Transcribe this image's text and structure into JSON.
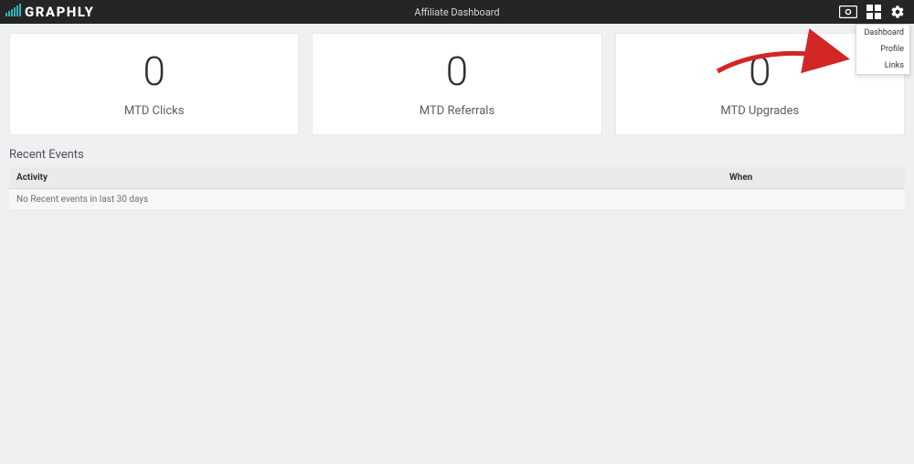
{
  "header": {
    "brand": "GRAPHLY",
    "title": "Affiliate Dashboard"
  },
  "dropdown": {
    "items": [
      "Dashboard",
      "Profile",
      "Links"
    ]
  },
  "cards": [
    {
      "value": "0",
      "label": "MTD Clicks"
    },
    {
      "value": "0",
      "label": "MTD Referrals"
    },
    {
      "value": "0",
      "label": "MTD Upgrades"
    }
  ],
  "recent_events": {
    "title": "Recent Events",
    "columns": {
      "activity": "Activity",
      "when": "When"
    },
    "empty_message": "No Recent events in last 30 days"
  },
  "colors": {
    "accent": "#35b5b5",
    "arrow": "#d32626"
  }
}
